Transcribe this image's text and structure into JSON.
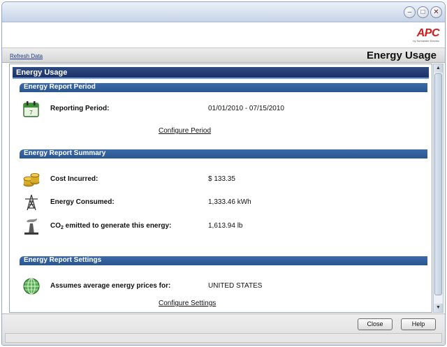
{
  "window": {
    "controls": [
      "minimize",
      "maximize",
      "close"
    ]
  },
  "brand": {
    "logo_text": "APC",
    "logo_sub": "by Schneider Electric",
    "logo_color": "#d21a1a"
  },
  "toolbar": {
    "refresh_label": "Refresh Data",
    "page_title": "Energy Usage"
  },
  "main": {
    "header": "Energy Usage",
    "period": {
      "header": "Energy Report Period",
      "icon": "calendar-icon",
      "label": "Reporting Period:",
      "value": "01/01/2010 - 07/15/2010",
      "configure_link": "Configure Period"
    },
    "summary": {
      "header": "Energy Report Summary",
      "rows": [
        {
          "icon": "coins-icon",
          "label": "Cost Incurred:",
          "value": "$ 133.35"
        },
        {
          "icon": "power-tower-icon",
          "label": "Energy Consumed:",
          "value": "1,333.46 kWh"
        },
        {
          "icon": "smokestack-icon",
          "label_pre": "CO",
          "label_sub": "2",
          "label_post": " emitted to generate this energy:",
          "value": "1,613.94 lb"
        }
      ]
    },
    "settings": {
      "header": "Energy Report Settings",
      "icon": "globe-icon",
      "label": "Assumes average energy prices for:",
      "value": "UNITED STATES",
      "configure_link": "Configure Settings"
    }
  },
  "footer": {
    "close_label": "Close",
    "help_label": "Help"
  },
  "colors": {
    "header_dark": "#1c3166",
    "section_blue": "#2a568f",
    "accent": "#6da0dc"
  }
}
